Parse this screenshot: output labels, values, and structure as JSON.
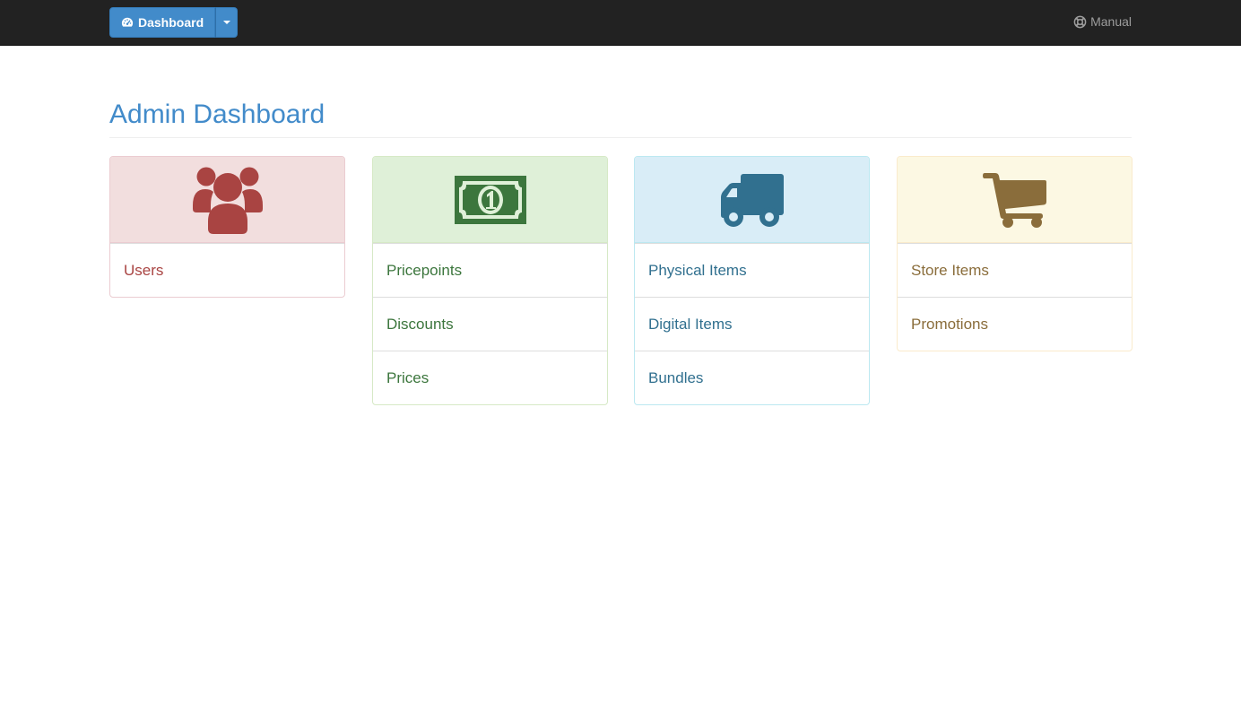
{
  "navbar": {
    "dashboard_label": "Dashboard",
    "dashboard_icon": "dashboard-gauge-icon",
    "manual_label": "Manual",
    "manual_icon": "lifebuoy-icon"
  },
  "page": {
    "title": "Admin Dashboard"
  },
  "panels": {
    "users": {
      "icon": "users-icon",
      "color": "#a94442",
      "items": [
        {
          "label": "Users"
        }
      ]
    },
    "pricing": {
      "icon": "money-bill-icon",
      "color": "#3c763d",
      "items": [
        {
          "label": "Pricepoints"
        },
        {
          "label": "Discounts"
        },
        {
          "label": "Prices"
        }
      ]
    },
    "items": {
      "icon": "truck-icon",
      "color": "#31708f",
      "items": [
        {
          "label": "Physical Items"
        },
        {
          "label": "Digital Items"
        },
        {
          "label": "Bundles"
        }
      ]
    },
    "store": {
      "icon": "shopping-cart-icon",
      "color": "#8a6d3b",
      "items": [
        {
          "label": "Store Items"
        },
        {
          "label": "Promotions"
        }
      ]
    }
  }
}
